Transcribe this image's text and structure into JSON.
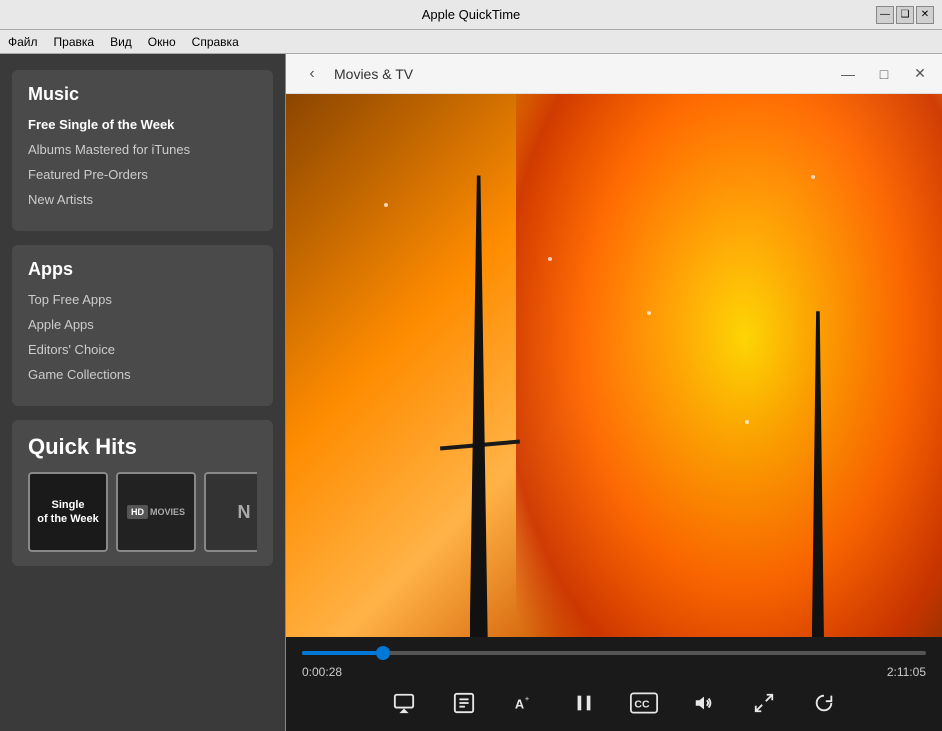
{
  "app": {
    "title": "Apple QuickTime",
    "minimize_label": "—",
    "restore_label": "❑",
    "close_label": "✕"
  },
  "menu": {
    "items": [
      "Файл",
      "Правка",
      "Вид",
      "Окно",
      "Справка"
    ]
  },
  "sidebar": {
    "music_section": {
      "title": "Music",
      "links": [
        {
          "id": "free-single",
          "label": "Free Single of the Week",
          "active": true
        },
        {
          "id": "albums-mastered",
          "label": "Albums Mastered for iTunes",
          "active": false
        },
        {
          "id": "featured-preorders",
          "label": "Featured Pre-Orders",
          "active": false
        },
        {
          "id": "new-artists",
          "label": "New Artists",
          "active": false
        }
      ]
    },
    "apps_section": {
      "title": "Apps",
      "links": [
        {
          "id": "top-free",
          "label": "Top Free Apps",
          "active": false
        },
        {
          "id": "apple-apps",
          "label": "Apple Apps",
          "active": false
        },
        {
          "id": "editors-choice",
          "label": "Editors' Choice",
          "active": false
        },
        {
          "id": "game-collections",
          "label": "Game Collections",
          "active": false
        }
      ]
    },
    "quick_hits": {
      "title": "Quick Hits",
      "items": [
        {
          "id": "single-week",
          "type": "single-week",
          "line1": "Single",
          "line2": "of the Week"
        },
        {
          "id": "hd-movies",
          "type": "hd-movies",
          "badge": "HD",
          "label": "MOVIES"
        },
        {
          "id": "third",
          "type": "empty",
          "label": "N"
        }
      ]
    }
  },
  "movies_tv_window": {
    "title": "Movies & TV",
    "back_icon": "‹",
    "controls": {
      "minimize": "—",
      "restore": "□",
      "close": "✕"
    }
  },
  "player": {
    "current_time": "0:00:28",
    "total_time": "2:11:05",
    "progress_percent": 13,
    "controls": [
      {
        "id": "airplay",
        "icon": "⬜",
        "label": "AirPlay"
      },
      {
        "id": "chapters",
        "icon": "⊟",
        "label": "Chapters"
      },
      {
        "id": "subtitles-text",
        "icon": "A+",
        "label": "Subtitles/Text"
      },
      {
        "id": "pause",
        "icon": "⏸",
        "label": "Pause"
      },
      {
        "id": "closed-captions",
        "icon": "CC",
        "label": "Closed Captions"
      },
      {
        "id": "volume",
        "icon": "🔊",
        "label": "Volume"
      },
      {
        "id": "fullscreen",
        "icon": "⤢",
        "label": "Fullscreen"
      },
      {
        "id": "replay",
        "icon": "↺",
        "label": "Replay"
      }
    ]
  }
}
